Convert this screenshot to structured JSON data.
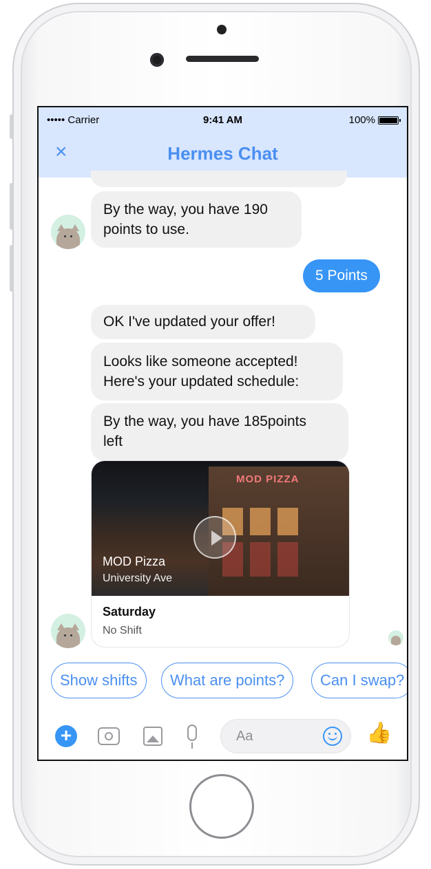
{
  "status_bar": {
    "carrier": "•••••  Carrier",
    "time": "9:41 AM",
    "battery": "100%"
  },
  "nav": {
    "close_icon": "×",
    "title": "Hermes Chat"
  },
  "messages": [
    {
      "from": "bot",
      "text_line1": "By the way, you have 190",
      "text_line2": "points to use."
    },
    {
      "from": "user",
      "text": "5 Points"
    },
    {
      "from": "bot",
      "text": "OK I've updated your offer!"
    },
    {
      "from": "bot",
      "text_line1": "Looks like someone accepted!",
      "text_line2": "Here's your updated schedule:"
    },
    {
      "from": "bot",
      "text_line1": "By the way, you have 185points",
      "text_line2": "left"
    }
  ],
  "card": {
    "sign": "MOD PIZZA",
    "image_title": "MOD Pizza",
    "image_subtitle": "University Ave",
    "day": "Saturday",
    "shift": "No Shift"
  },
  "quick_replies": [
    "Show shifts",
    "What are points?",
    "Can I swap?"
  ],
  "composer": {
    "placeholder": "Aa",
    "plus_icon": "+",
    "like_icon": "👍"
  },
  "colors": {
    "accent": "#3795f6",
    "header_bg": "#d8e6fe",
    "bubble_in": "#f1f0f0"
  }
}
